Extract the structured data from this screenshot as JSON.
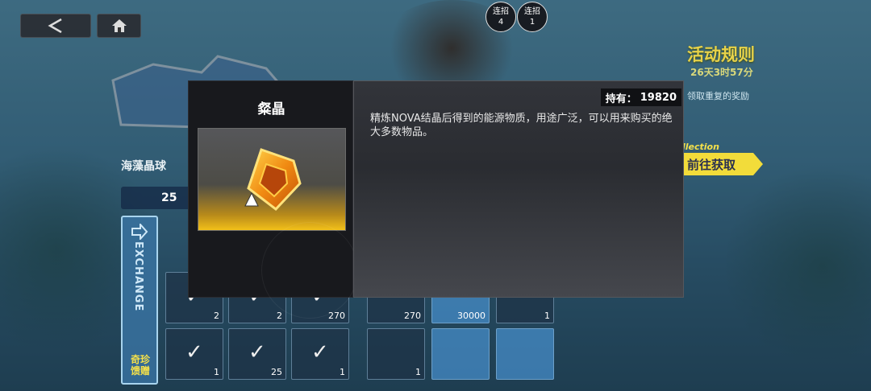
{
  "top_bar": {
    "back_icon": "back-arrow-icon",
    "home_icon": "home-icon",
    "combos": [
      {
        "label": "连招",
        "value": "4"
      },
      {
        "label": "连招",
        "value": "1"
      }
    ]
  },
  "event": {
    "title": "活动规则",
    "time_left": "26天3时57分",
    "note": "领取重复的奖励",
    "collection_label": "llection",
    "goto_label": "前往获取"
  },
  "shop": {
    "label": "海藻晶球",
    "currency_value": "25",
    "side_tab_text": "EXCHANGE",
    "side_tab_cn": "奇珍馈赠",
    "row1_qty": [
      "2",
      "2",
      "270",
      "270",
      "30000",
      "1"
    ],
    "row2_qty": [
      "1",
      "25",
      "1",
      "1"
    ]
  },
  "modal": {
    "item_name": "粲晶",
    "owned_label": "持有：",
    "owned_value": "19820",
    "description": "精炼NOVA结晶后得到的能源物质，用途广泛，可以用来购买的绝大多数物品。",
    "accent_color": "#f2c019"
  }
}
